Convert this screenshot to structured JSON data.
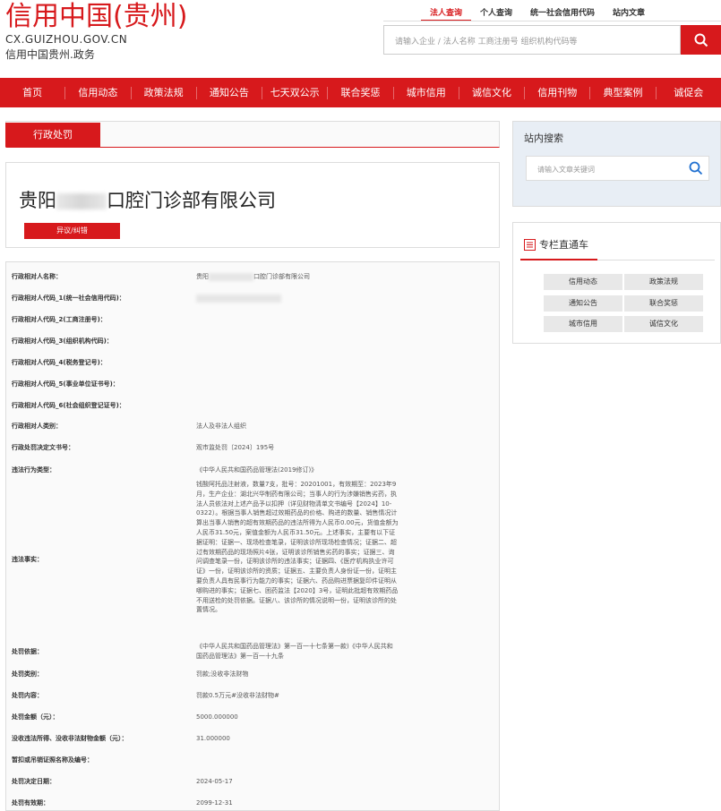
{
  "logo": {
    "title": "信用中国(贵州)",
    "domain": "CX.GUIZHOU.GOV.CN",
    "subtitle": "信用中国贵州.政务"
  },
  "top_tabs": [
    "法人查询",
    "个人查询",
    "统一社会信用代码",
    "站内文章"
  ],
  "search": {
    "placeholder": "请输入企业 / 法人名称 工商注册号 组织机构代码等"
  },
  "nav": [
    "首页",
    "信用动态",
    "政策法规",
    "通知公告",
    "七天双公示",
    "联合奖惩",
    "城市信用",
    "诚信文化",
    "信用刊物",
    "典型案例",
    "诚促会"
  ],
  "section_tab": "行政处罚",
  "company": {
    "name_prefix": "贵阳",
    "name_suffix": "口腔门诊部有限公司",
    "objection_label": "异议/纠错"
  },
  "details": [
    {
      "label": "行政相对人名称：",
      "value_prefix": "贵阳",
      "value_suffix": "口腔门诊部有限公司"
    },
    {
      "label": "行政相对人代码_1(统一社会信用代码)：",
      "value": ""
    },
    {
      "label": "行政相对人代码_2(工商注册号)：",
      "value": ""
    },
    {
      "label": "行政相对人代码_3(组织机构代码)：",
      "value": ""
    },
    {
      "label": "行政相对人代码_4(税务登记号)：",
      "value": ""
    },
    {
      "label": "行政相对人代码_5(事业单位证书号)：",
      "value": ""
    },
    {
      "label": "行政相对人代码_6(社会组织登记证号)：",
      "value": ""
    },
    {
      "label": "行政相对人类别：",
      "value": "法人及非法人组织"
    },
    {
      "label": "行政处罚决定文书号：",
      "value": "观市监处罚〔2024〕195号"
    },
    {
      "label": "违法行为类型：",
      "value": "《中华人民共和国药品管理法(2019修订)》"
    },
    {
      "label": "违法事实：",
      "value": "钱酸阿托品注射液，数量7支，批号：20201001，有效期至：2023年9月，生产企业：湖北兴华制药有限公司；当事人的行为涉嫌销售劣药，执法人员依法对上述产品予以扣押（详见财物清单文书编号【2024】10-0322）。根据当事人销售超过效期药品的价格、购进的数量、销售情况计算出当事人销售的超有效期药品的违法所得为人民币0.00元，货值金额为人民币31.50元，案值金额为人民币31.50元。上述事实，主要有以下证据证明：证据一、现场检查笔录，证明该诊所现场检查情况；证据二、超过有效期药品的现场照片4张，证明该诊所销售劣药的事实；证据三、询问调查笔录一份，证明该诊所的违法事实；证据四、《医疗机构执业许可证》一份，证明该诊所的资质；证据五、主要负责人身份证一份，证明主要负责人具有民事行为能力的事实；证据六、药品购进票据复印件证明从哪购进的事实；证据七、困药监法【2020】3号，证明此批超有效期药品不用送检的处罚依据。证据八、该诊所的情况说明一份，证明该诊所的处置情况。"
    },
    {
      "label": "处罚依据：",
      "value": "《中华人民共和国药品管理法》第一百一十七条第一款)《中华人民共和国药品管理法》第一百一十九条"
    },
    {
      "label": "处罚类别：",
      "value": "罚款;没收非法财物"
    },
    {
      "label": "处罚内容：",
      "value": "罚款0.5万元#没收非法财物#"
    },
    {
      "label": "处罚金额（元）：",
      "value": "5000.000000"
    },
    {
      "label": "没收违法所得、没收非法财物金额（元）：",
      "value": "31.000000"
    },
    {
      "label": "暂扣或吊销证照名称及编号：",
      "value": ""
    },
    {
      "label": "处罚决定日期：",
      "value": "2024-05-17"
    },
    {
      "label": "处罚有效期：",
      "value": "2099-12-31"
    }
  ],
  "site_search": {
    "title": "站内搜索",
    "placeholder": "请输入文章关键词"
  },
  "column": {
    "title": "专栏直通车",
    "buttons": [
      "信用动态",
      "政策法规",
      "通知公告",
      "联合奖惩",
      "城市信用",
      "诚信文化"
    ]
  },
  "colors": {
    "brand_red": "#d7191c",
    "panel_blue": "#e8eef5"
  }
}
